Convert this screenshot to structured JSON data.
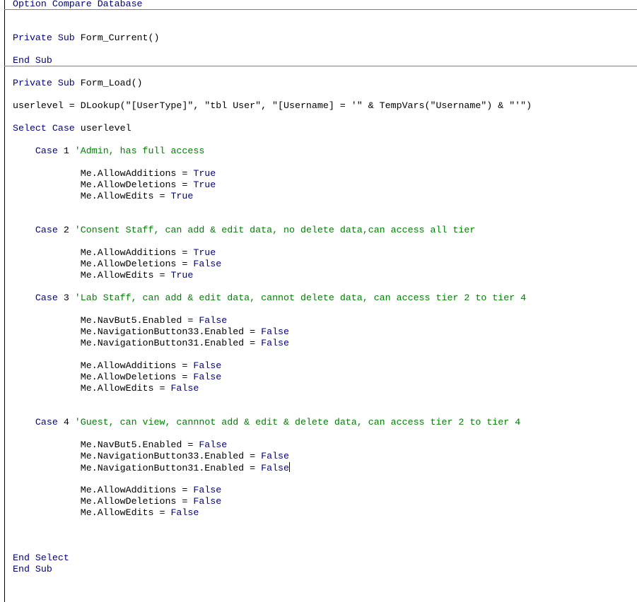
{
  "editor": {
    "colors": {
      "keyword": "#00008B",
      "comment": "#008000",
      "text": "#000000"
    },
    "cursor_line": 41,
    "lines": [
      [
        {
          "t": "Option Compare Database",
          "k": "kw"
        }
      ],
      [],
      [],
      [
        {
          "t": "Private Sub",
          "k": "kw"
        },
        {
          "t": " Form_Current()",
          "k": ""
        }
      ],
      [],
      [
        {
          "t": "End Sub",
          "k": "kw"
        }
      ],
      [],
      [
        {
          "t": "Private Sub",
          "k": "kw"
        },
        {
          "t": " Form_Load()",
          "k": ""
        }
      ],
      [],
      [
        {
          "t": "userlevel = DLookup(\"[UserType]\", \"tbl User\", \"[Username] = '\" & TempVars(\"Username\") & \"'\")",
          "k": ""
        }
      ],
      [],
      [
        {
          "t": "Select Case",
          "k": "kw"
        },
        {
          "t": " userlevel",
          "k": ""
        }
      ],
      [],
      [
        {
          "t": "    ",
          "k": ""
        },
        {
          "t": "Case",
          "k": "kw"
        },
        {
          "t": " 1 ",
          "k": ""
        },
        {
          "t": "'Admin, has full access",
          "k": "cm"
        }
      ],
      [],
      [
        {
          "t": "            Me.AllowAdditions = ",
          "k": ""
        },
        {
          "t": "True",
          "k": "kw"
        }
      ],
      [
        {
          "t": "            Me.AllowDeletions = ",
          "k": ""
        },
        {
          "t": "True",
          "k": "kw"
        }
      ],
      [
        {
          "t": "            Me.AllowEdits = ",
          "k": ""
        },
        {
          "t": "True",
          "k": "kw"
        }
      ],
      [],
      [],
      [
        {
          "t": "    ",
          "k": ""
        },
        {
          "t": "Case",
          "k": "kw"
        },
        {
          "t": " 2 ",
          "k": ""
        },
        {
          "t": "'Consent Staff, can add & edit data, no delete data,can access all tier",
          "k": "cm"
        }
      ],
      [],
      [
        {
          "t": "            Me.AllowAdditions = ",
          "k": ""
        },
        {
          "t": "True",
          "k": "kw"
        }
      ],
      [
        {
          "t": "            Me.AllowDeletions = ",
          "k": ""
        },
        {
          "t": "False",
          "k": "kw"
        }
      ],
      [
        {
          "t": "            Me.AllowEdits = ",
          "k": ""
        },
        {
          "t": "True",
          "k": "kw"
        }
      ],
      [],
      [
        {
          "t": "    ",
          "k": ""
        },
        {
          "t": "Case",
          "k": "kw"
        },
        {
          "t": " 3 ",
          "k": ""
        },
        {
          "t": "'Lab Staff, can add & edit data, cannot delete data, can access tier 2 to tier 4",
          "k": "cm"
        }
      ],
      [],
      [
        {
          "t": "            Me.NavBut5.Enabled = ",
          "k": ""
        },
        {
          "t": "False",
          "k": "kw"
        }
      ],
      [
        {
          "t": "            Me.NavigationButton33.Enabled = ",
          "k": ""
        },
        {
          "t": "False",
          "k": "kw"
        }
      ],
      [
        {
          "t": "            Me.NavigationButton31.Enabled = ",
          "k": ""
        },
        {
          "t": "False",
          "k": "kw"
        }
      ],
      [],
      [
        {
          "t": "            Me.AllowAdditions = ",
          "k": ""
        },
        {
          "t": "False",
          "k": "kw"
        }
      ],
      [
        {
          "t": "            Me.AllowDeletions = ",
          "k": ""
        },
        {
          "t": "False",
          "k": "kw"
        }
      ],
      [
        {
          "t": "            Me.AllowEdits = ",
          "k": ""
        },
        {
          "t": "False",
          "k": "kw"
        }
      ],
      [],
      [],
      [
        {
          "t": "    ",
          "k": ""
        },
        {
          "t": "Case",
          "k": "kw"
        },
        {
          "t": " 4 ",
          "k": ""
        },
        {
          "t": "'Guest, can view, cannnot add & edit & delete data, can access tier 2 to tier 4",
          "k": "cm"
        }
      ],
      [],
      [
        {
          "t": "            Me.NavBut5.Enabled = ",
          "k": ""
        },
        {
          "t": "False",
          "k": "kw"
        }
      ],
      [
        {
          "t": "            Me.NavigationButton33.Enabled = ",
          "k": ""
        },
        {
          "t": "False",
          "k": "kw"
        }
      ],
      [
        {
          "t": "            Me.NavigationButton31.Enabled = ",
          "k": ""
        },
        {
          "t": "False",
          "k": "kw"
        }
      ],
      [],
      [
        {
          "t": "            Me.AllowAdditions = ",
          "k": ""
        },
        {
          "t": "False",
          "k": "kw"
        }
      ],
      [
        {
          "t": "            Me.AllowDeletions = ",
          "k": ""
        },
        {
          "t": "False",
          "k": "kw"
        }
      ],
      [
        {
          "t": "            Me.AllowEdits = ",
          "k": ""
        },
        {
          "t": "False",
          "k": "kw"
        }
      ],
      [],
      [],
      [],
      [
        {
          "t": "End Select",
          "k": "kw"
        }
      ],
      [
        {
          "t": "End Sub",
          "k": "kw"
        }
      ]
    ]
  }
}
